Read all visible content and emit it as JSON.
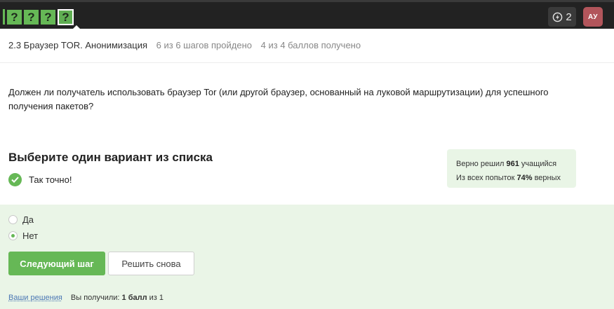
{
  "step_nav": {
    "steps": [
      {
        "label": "",
        "state": "done"
      },
      {
        "label": "?",
        "state": "done"
      },
      {
        "label": "?",
        "state": "done"
      },
      {
        "label": "?",
        "state": "done"
      },
      {
        "label": "?",
        "state": "current"
      }
    ]
  },
  "topbar": {
    "energy_count": "2",
    "energy_icon": "lightning-icon",
    "avatar_initials": "АУ"
  },
  "lesson": {
    "title": "2.3 Браузер TOR. Анонимизация",
    "steps_progress": "6 из 6 шагов пройдено",
    "points_progress": "4 из 4 баллов  получено"
  },
  "question": {
    "text": "Должен ли получатель использовать браузер Tor (или другой браузер, основанный на луковой маршрутизации) для успешного получения пакетов?"
  },
  "task": {
    "title": "Выберите один вариант из списка",
    "feedback": "Так точно!",
    "feedback_icon": "check-icon"
  },
  "stats": {
    "solved_prefix": "Верно решил ",
    "solved_count": "961",
    "solved_suffix": " учащийся",
    "attempts_prefix": "Из всех попыток ",
    "attempts_percent": "74%",
    "attempts_suffix": " верных"
  },
  "options": [
    {
      "label": "Да",
      "selected": false
    },
    {
      "label": "Нет",
      "selected": true
    }
  ],
  "buttons": {
    "next": "Следующий шаг",
    "retry": "Решить снова"
  },
  "footer": {
    "solutions_link": "Ваши решения",
    "score_prefix": "Вы получили: ",
    "score_value": "1 балл",
    "score_middle": " из ",
    "score_max": "1"
  },
  "colors": {
    "accent": "#66b856",
    "topbar": "#222222",
    "answer_bg": "#eaf5e7",
    "stats_bg": "#e9f5e6",
    "avatar_bg": "#b2555b",
    "link": "#4b77b4"
  }
}
